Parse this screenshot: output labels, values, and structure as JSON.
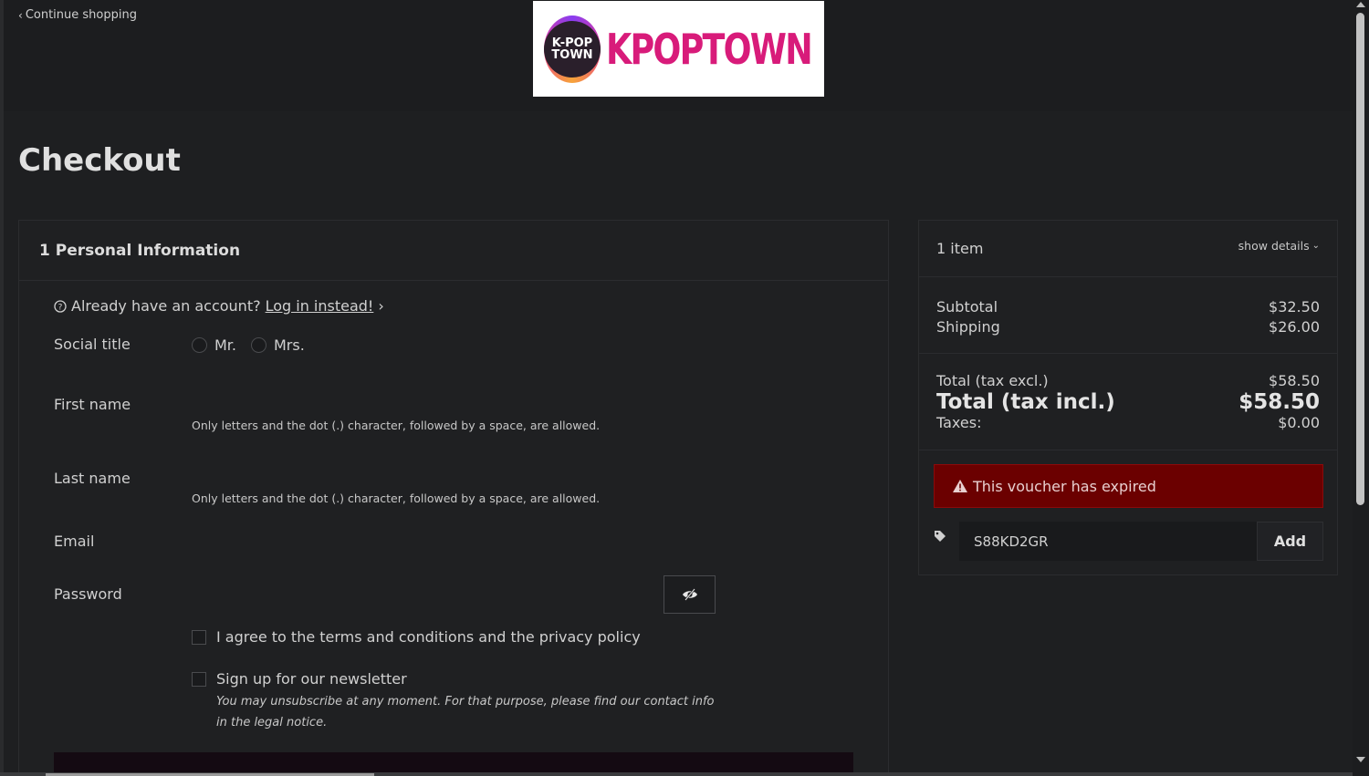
{
  "header": {
    "continue_label": "Continue shopping",
    "logo_badge_line1": "K-POP",
    "logo_badge_line2": "TOWN",
    "logo_text": "KPOPTOWN"
  },
  "page_title": "Checkout",
  "personal": {
    "step_title": "1 Personal Information",
    "account_question": "Already have an account?",
    "login_link": "Log in instead!",
    "social_title_label": "Social title",
    "social_options": [
      "Mr.",
      "Mrs."
    ],
    "first_name_label": "First name",
    "first_name_hint": "Only letters and the dot (.) character, followed by a space, are allowed.",
    "last_name_label": "Last name",
    "last_name_hint": "Only letters and the dot (.) character, followed by a space, are allowed.",
    "email_label": "Email",
    "password_label": "Password",
    "terms_label": "I agree to the terms and conditions and the privacy policy",
    "newsletter_label": "Sign up for our newsletter",
    "newsletter_note": "You may unsubscribe at any moment. For that purpose, please find our contact info in the legal notice."
  },
  "summary": {
    "item_count": "1 item",
    "show_details": "show details",
    "subtotal_label": "Subtotal",
    "subtotal_value": "$32.50",
    "shipping_label": "Shipping",
    "shipping_value": "$26.00",
    "total_excl_label": "Total (tax excl.)",
    "total_excl_value": "$58.50",
    "total_incl_label": "Total (tax incl.)",
    "total_incl_value": "$58.50",
    "taxes_label": "Taxes:",
    "taxes_value": "$0.00",
    "voucher_error": "This voucher has expired",
    "voucher_code": "S88KD2GR",
    "add_label": "Add"
  },
  "colors": {
    "brand": "#d81b7a",
    "alert_bg": "#6b0000",
    "background": "#1e1f21"
  }
}
